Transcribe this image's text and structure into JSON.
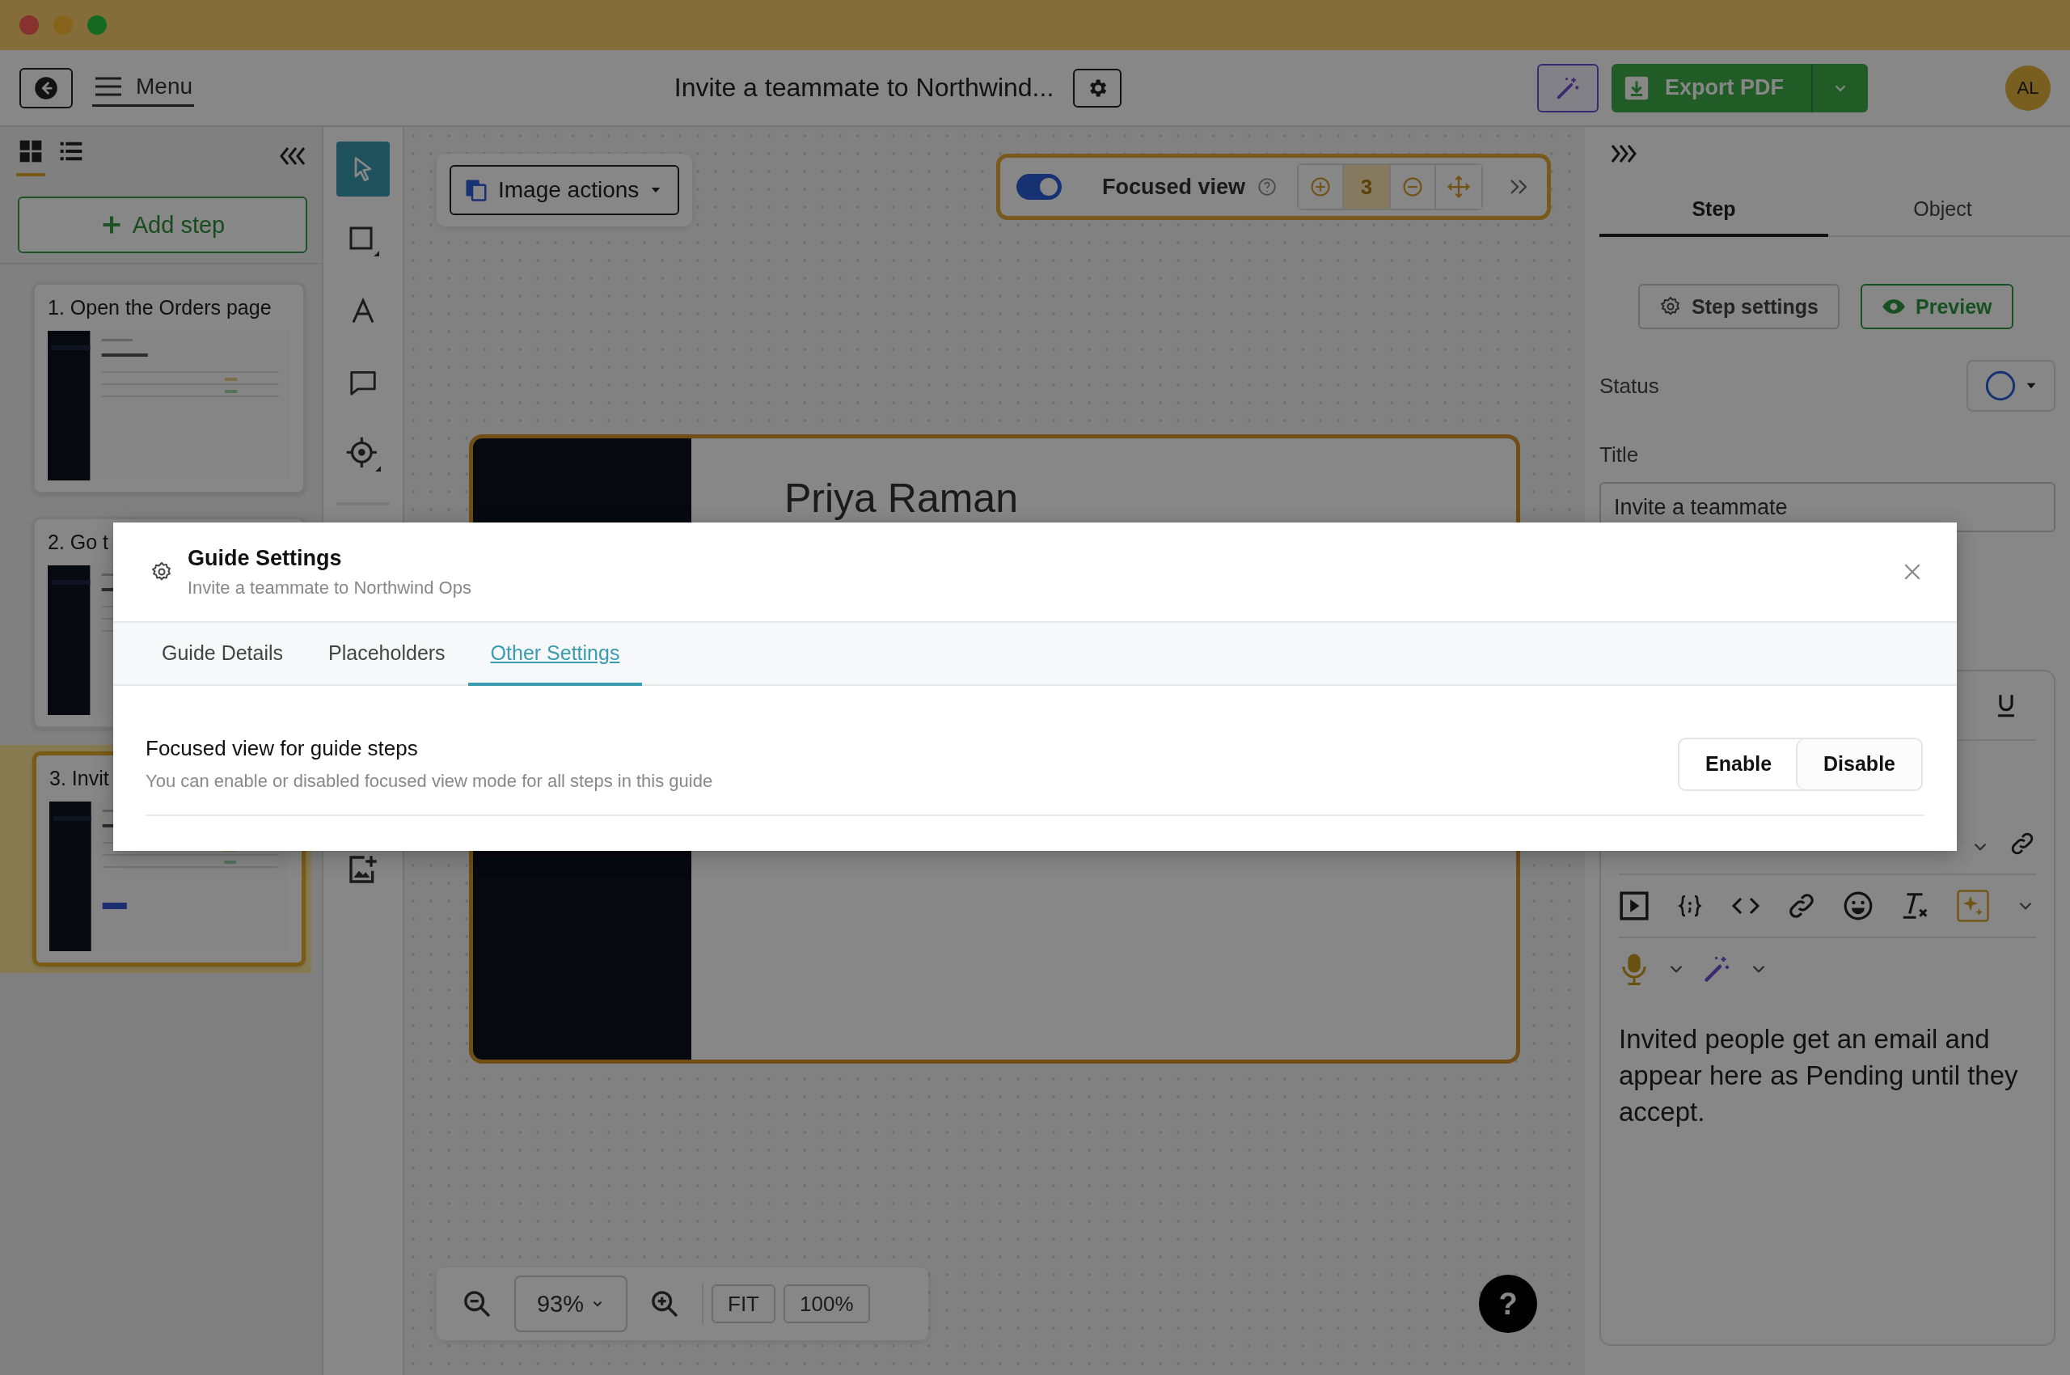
{
  "window": {
    "title": "Invite a teammate to Northwind..."
  },
  "header": {
    "menu_label": "Menu",
    "export_label": "Export PDF",
    "avatar": "AL"
  },
  "sidebar": {
    "views": [
      {
        "kind": "grid",
        "selected": true
      },
      {
        "kind": "list",
        "selected": false
      }
    ],
    "add_step": "Add step",
    "steps": [
      {
        "title": "1. Open the Orders page",
        "selected": false
      },
      {
        "title": "2. Go t",
        "selected": false
      },
      {
        "title": "3. Invit",
        "selected": true
      }
    ]
  },
  "tools": [
    {
      "kind": "pointer",
      "selected": true
    },
    {
      "kind": "rect",
      "selected": false
    },
    {
      "kind": "text",
      "selected": false
    },
    {
      "kind": "comment",
      "selected": false
    },
    {
      "kind": "target",
      "selected": false
    }
  ],
  "canvas": {
    "image_actions": "Image actions",
    "focused_view": {
      "on": true,
      "label": "Focused view",
      "step": "3"
    },
    "heading": "Priya Raman",
    "zoom": "93%",
    "fit": "FIT",
    "actual": "100%",
    "help": "?"
  },
  "right_panel": {
    "tabs": [
      {
        "label": "Step",
        "selected": true
      },
      {
        "label": "Object",
        "selected": false
      }
    ],
    "step_settings": "Step settings",
    "preview": "Preview",
    "status_label": "Status",
    "title_label": "Title",
    "title_value": "Invite a teammate",
    "body": "Invited people get an email and appear here as Pending until they accept."
  },
  "dialog": {
    "title": "Guide Settings",
    "subtitle": "Invite a teammate to Northwind Ops",
    "tabs": [
      {
        "label": "Guide Details",
        "selected": false
      },
      {
        "label": "Placeholders",
        "selected": false
      },
      {
        "label": "Other Settings",
        "selected": true
      }
    ],
    "settings": [
      {
        "title": "Focused view for guide steps",
        "description": "You can enable or disabled focused view mode for all steps in this guide",
        "options": [
          {
            "label": "Enable",
            "selected": false
          },
          {
            "label": "Disable",
            "selected": true
          }
        ]
      }
    ]
  }
}
